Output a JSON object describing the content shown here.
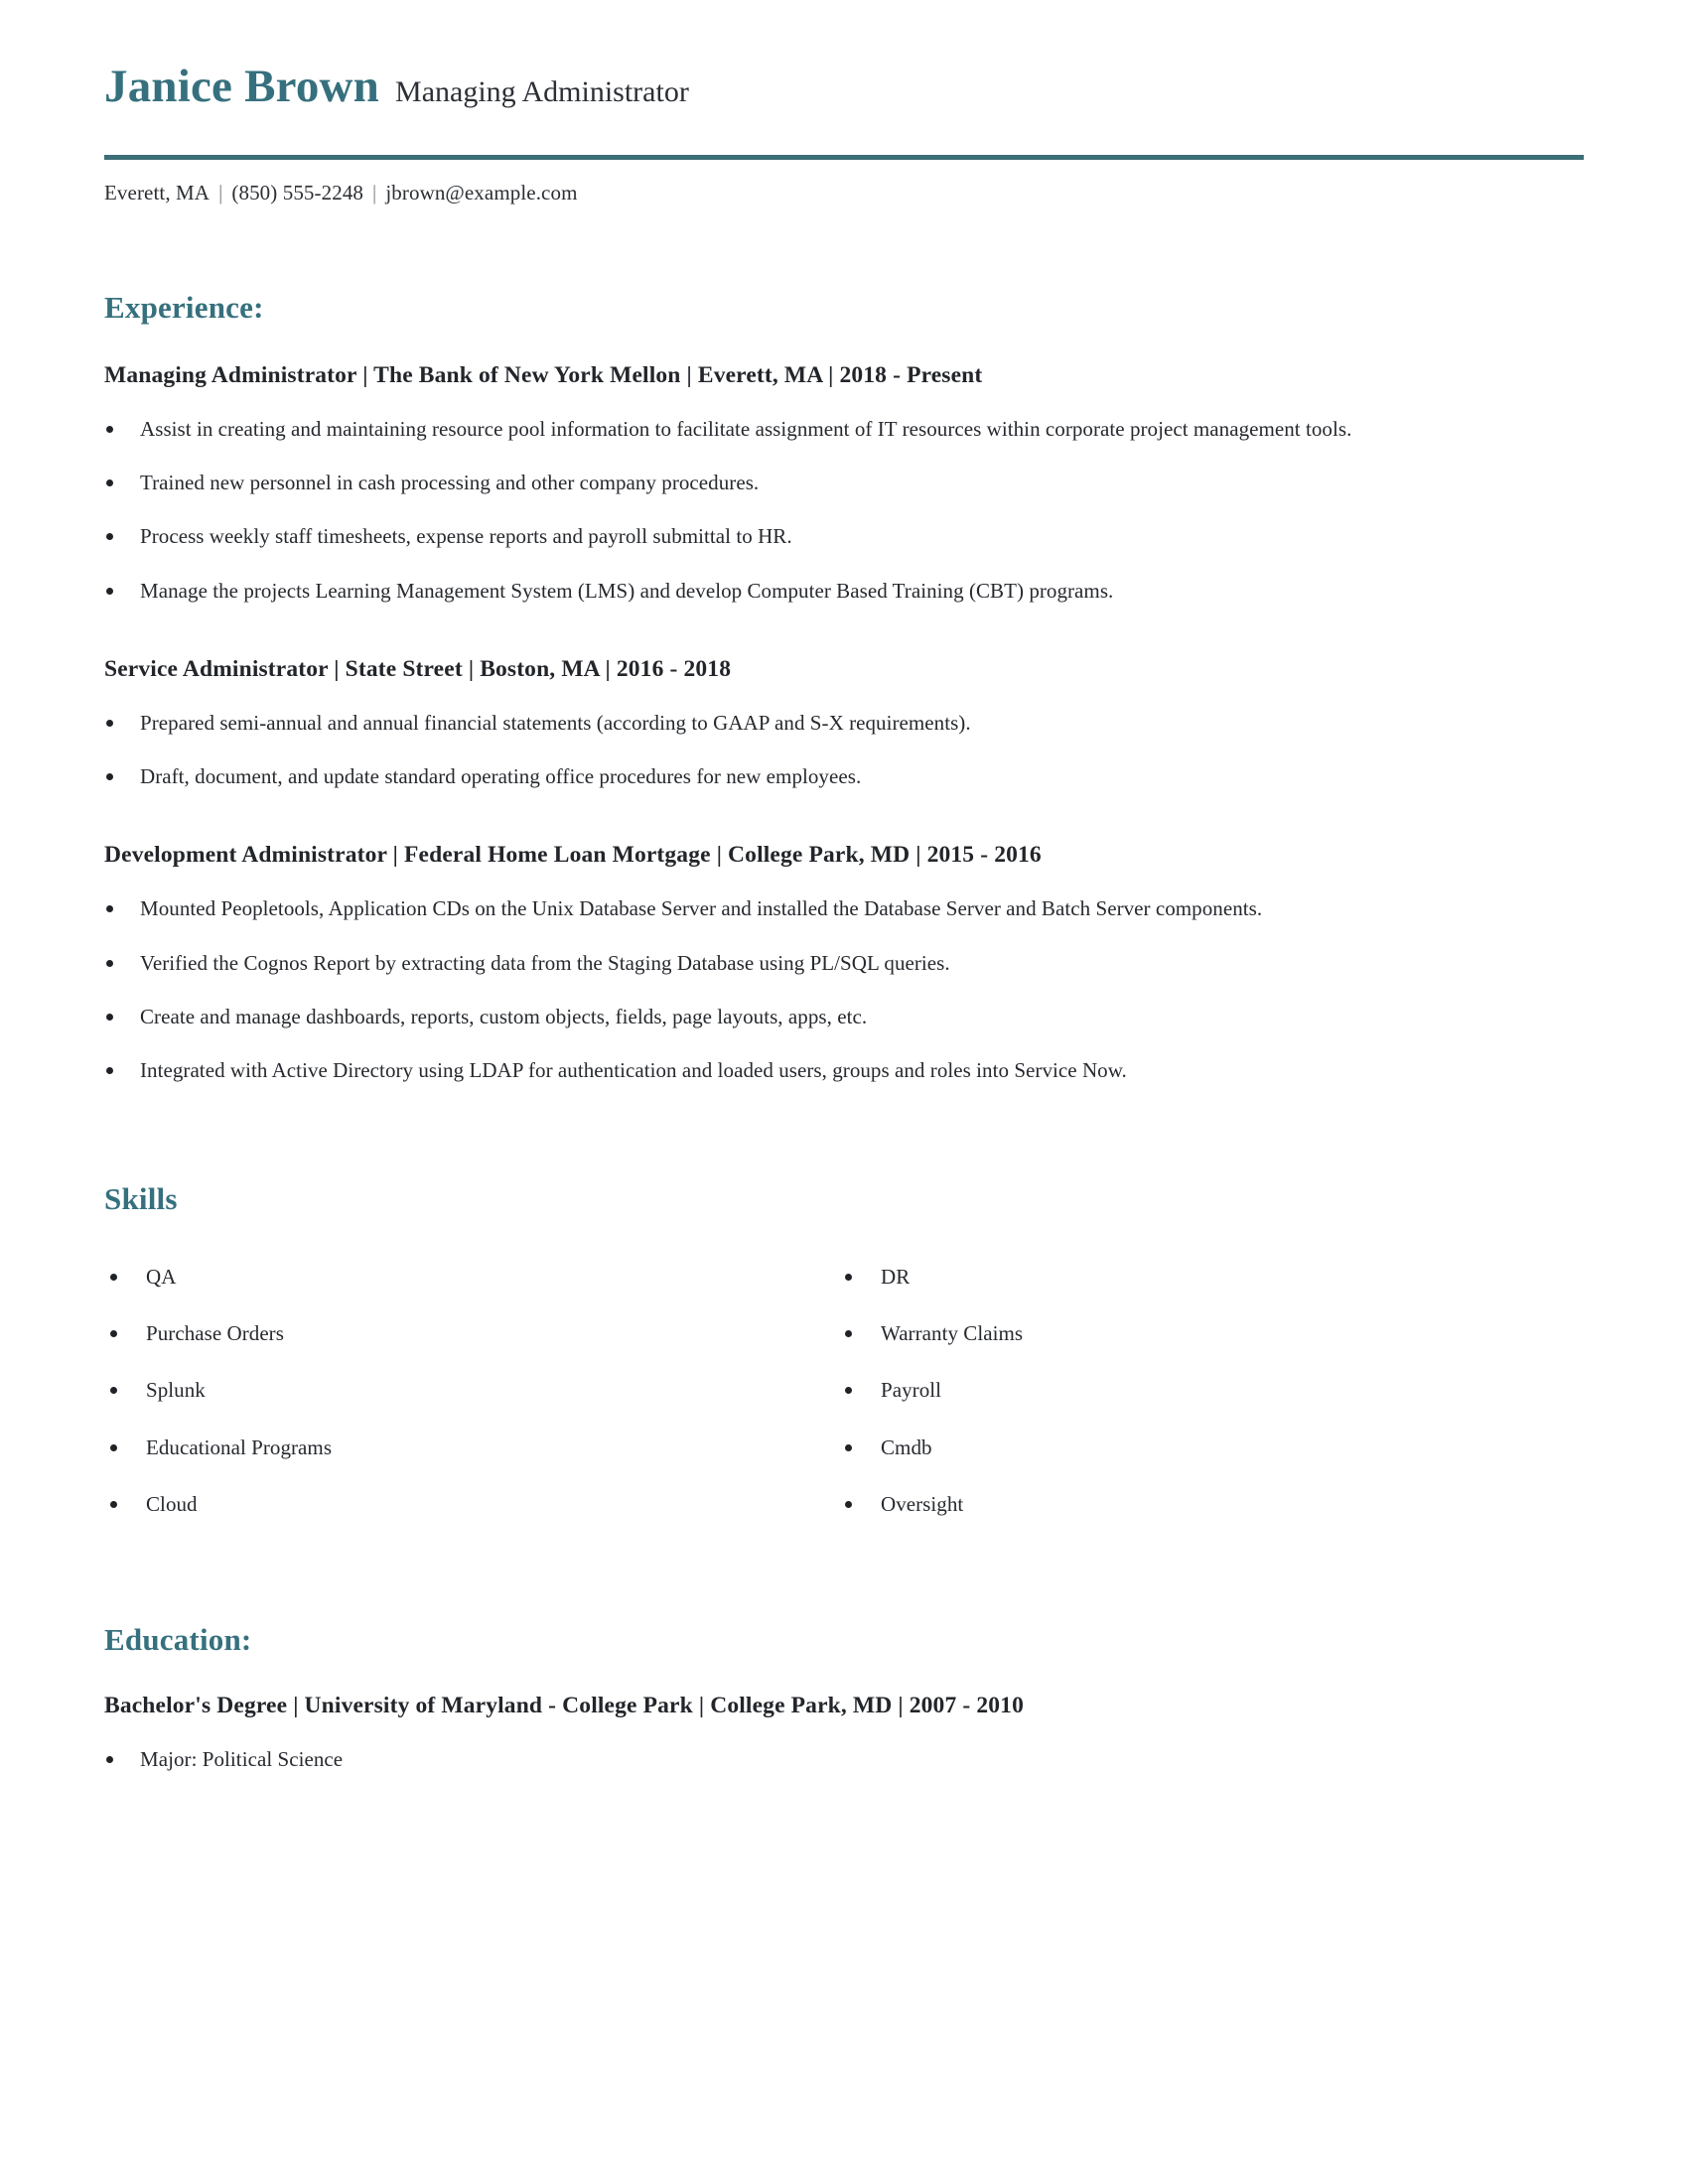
{
  "header": {
    "name": "Janice Brown",
    "job_title": "Managing Administrator",
    "accent_color": "#36707e",
    "rule_color": "#3d6e78"
  },
  "contact": {
    "location": "Everett, MA",
    "phone": "(850) 555-2248",
    "email": "jbrown@example.com",
    "separator": "|"
  },
  "experience": {
    "heading": "Experience:",
    "entries": [
      {
        "heading": "Managing Administrator | The Bank of New York Mellon | Everett, MA | 2018 - Present",
        "bullets": [
          "Assist in creating and maintaining resource pool information to facilitate assignment of IT resources within corporate project management tools.",
          "Trained new personnel in cash processing and other company procedures.",
          "Process weekly staff timesheets, expense reports and payroll submittal to HR.",
          "Manage the projects Learning Management System (LMS) and develop Computer Based Training (CBT) programs."
        ]
      },
      {
        "heading": "Service Administrator | State Street | Boston, MA | 2016 - 2018",
        "bullets": [
          "Prepared semi-annual and annual financial statements (according to GAAP and S-X requirements).",
          "Draft, document, and update standard operating office procedures for new employees."
        ]
      },
      {
        "heading": "Development Administrator | Federal Home Loan Mortgage | College Park, MD | 2015 - 2016",
        "bullets": [
          "Mounted Peopletools, Application CDs on the Unix Database Server and installed the Database Server and Batch Server components.",
          "Verified the Cognos Report by extracting data from the Staging Database using PL/SQL queries.",
          "Create and manage dashboards, reports, custom objects, fields, page layouts, apps, etc.",
          "Integrated with Active Directory using LDAP for authentication and loaded users, groups and roles into Service Now."
        ]
      }
    ]
  },
  "skills": {
    "heading": "Skills",
    "column_left": [
      "QA",
      "Purchase Orders",
      "Splunk",
      "Educational Programs",
      "Cloud"
    ],
    "column_right": [
      "DR",
      "Warranty Claims",
      "Payroll",
      "Cmdb",
      "Oversight"
    ]
  },
  "education": {
    "heading": "Education:",
    "entries": [
      {
        "heading": "Bachelor's Degree | University of Maryland - College Park | College Park, MD | 2007 - 2010",
        "bullets": [
          "Major: Political Science"
        ]
      }
    ]
  }
}
